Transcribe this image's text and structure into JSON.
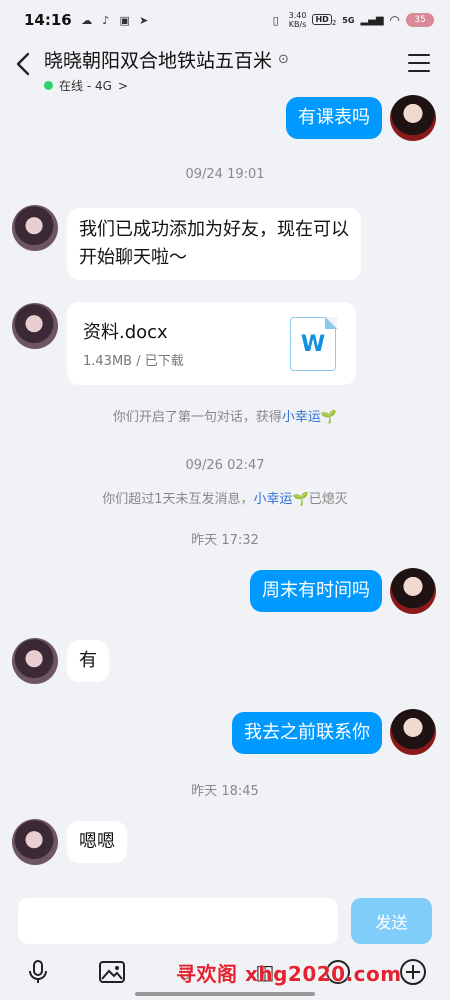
{
  "status_bar": {
    "time": "14:16",
    "net_speed_value": "3.40",
    "net_speed_unit": "KB/s",
    "hd_label": "HD",
    "hd_sub": "2",
    "signal_label": "5G",
    "battery": "35"
  },
  "header": {
    "title": "晓晓朝阳双合地铁站五百米",
    "status": "在线 - 4G",
    "status_arrow": ">"
  },
  "messages": {
    "m1": "有课表吗",
    "t1": "09/24 19:01",
    "m2_line1": "我们已成功添加为好友，现在可以",
    "m2_line2": "开始聊天啦～",
    "file": {
      "name": "资料.docx",
      "meta": "1.43MB / 已下载",
      "icon_letter": "W"
    },
    "sys1_prefix": "你们开启了第一句对话，获得",
    "sys1_link": "小幸运",
    "t2": "09/26 02:47",
    "sys2_prefix": "你们超过1天未互发消息，",
    "sys2_link": "小幸运",
    "sys2_suffix": "已熄灭",
    "t3": "昨天 17:32",
    "m3": "周末有时间吗",
    "m4": "有",
    "m5": "我去之前联系你",
    "t4": "昨天 18:45",
    "m6": "嗯嗯"
  },
  "input": {
    "placeholder": "",
    "send_label": "发送"
  },
  "watermark": "寻欢阁 xhg2020.com",
  "icons": {
    "mic": "mic-icon",
    "image": "image-icon",
    "camera": "camera-icon",
    "emoji": "emoji-icon",
    "plus": "plus-icon"
  }
}
